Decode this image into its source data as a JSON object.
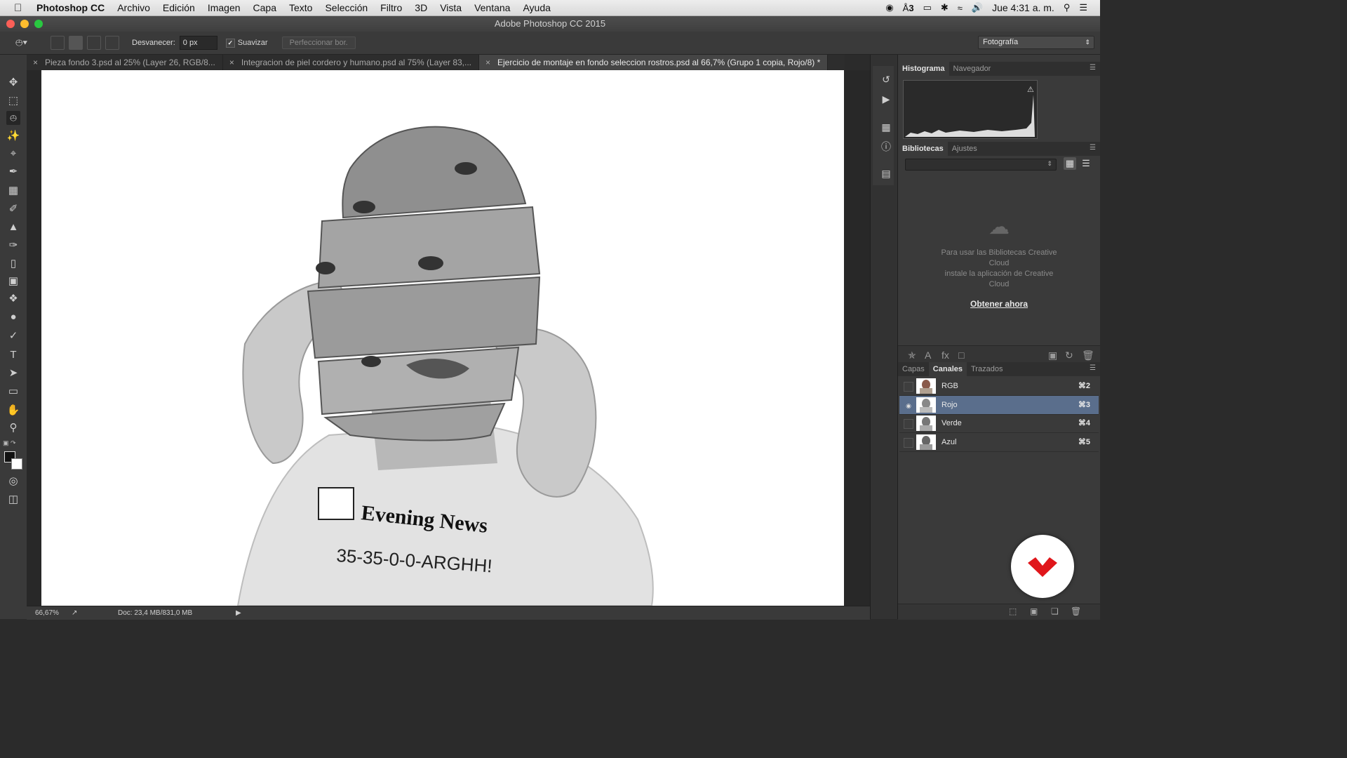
{
  "menubar": {
    "app": "Photoshop CC",
    "items": [
      "Archivo",
      "Edición",
      "Imagen",
      "Capa",
      "Texto",
      "Selección",
      "Filtro",
      "3D",
      "Vista",
      "Ventana",
      "Ayuda"
    ],
    "adobe_count": "3",
    "clock": "Jue 4:31 a. m."
  },
  "window": {
    "title": "Adobe Photoshop CC 2015"
  },
  "options": {
    "feather_label": "Desvanecer:",
    "feather_value": "0 px",
    "antialias_label": "Suavizar",
    "refine_label": "Perfeccionar bor.",
    "workspace": "Fotografía"
  },
  "tabs": [
    {
      "label": "Pieza fondo 3.psd al 25% (Layer 26, RGB/8..."
    },
    {
      "label": "Integracion de piel cordero y humano.psd al 75% (Layer 83,..."
    },
    {
      "label": "Ejercicio de montaje en fondo seleccion rostros.psd al 66,7% (Grupo 1 copia, Rojo/8) *"
    }
  ],
  "status": {
    "zoom": "66,67%",
    "doc": "Doc: 23,4 MB/831,0 MB"
  },
  "panels": {
    "top_tabs": [
      "Histograma",
      "Navegador"
    ],
    "lib_tabs": [
      "Bibliotecas",
      "Ajustes"
    ],
    "lib_message": [
      "Para usar las Bibliotecas Creative",
      "Cloud",
      "instale la aplicación de Creative",
      "Cloud"
    ],
    "lib_link": "Obtener ahora",
    "layer_tabs": [
      "Capas",
      "Canales",
      "Trazados"
    ],
    "channels": [
      {
        "name": "RGB",
        "shortcut": "⌘2"
      },
      {
        "name": "Rojo",
        "shortcut": "⌘3"
      },
      {
        "name": "Verde",
        "shortcut": "⌘4"
      },
      {
        "name": "Azul",
        "shortcut": "⌘5"
      }
    ]
  },
  "canvas_text": {
    "shirt_headline": "Evening News",
    "shirt_slogan": "35-35-0-0-ARGHH!"
  },
  "colors": {
    "accent": "#5a6e8c",
    "badge_red": "#e0161b"
  }
}
